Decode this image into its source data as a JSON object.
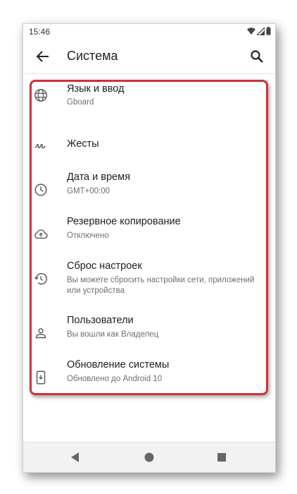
{
  "status_bar": {
    "time": "15:46"
  },
  "app_bar": {
    "title": "Система"
  },
  "settings": [
    {
      "title": "Язык и ввод",
      "subtitle": "Gboard",
      "icon": "globe-icon"
    },
    {
      "title": "Жесты",
      "subtitle": "",
      "icon": "gesture-icon"
    },
    {
      "title": "Дата и время",
      "subtitle": "GMT+00:00",
      "icon": "clock-icon"
    },
    {
      "title": "Резервное копирование",
      "subtitle": "Отключено",
      "icon": "cloud-upload-icon"
    },
    {
      "title": "Сброс настроек",
      "subtitle": "Вы можете сбросить настройки сети, приложений или устройства",
      "icon": "history-icon"
    },
    {
      "title": "Пользователи",
      "subtitle": "Вы вошли как Владелец",
      "icon": "person-icon"
    },
    {
      "title": "Обновление системы",
      "subtitle": "Обновлено до Android 10",
      "icon": "system-update-icon"
    }
  ],
  "colors": {
    "highlight": "#d32f3a",
    "icon": "#5f6368"
  }
}
